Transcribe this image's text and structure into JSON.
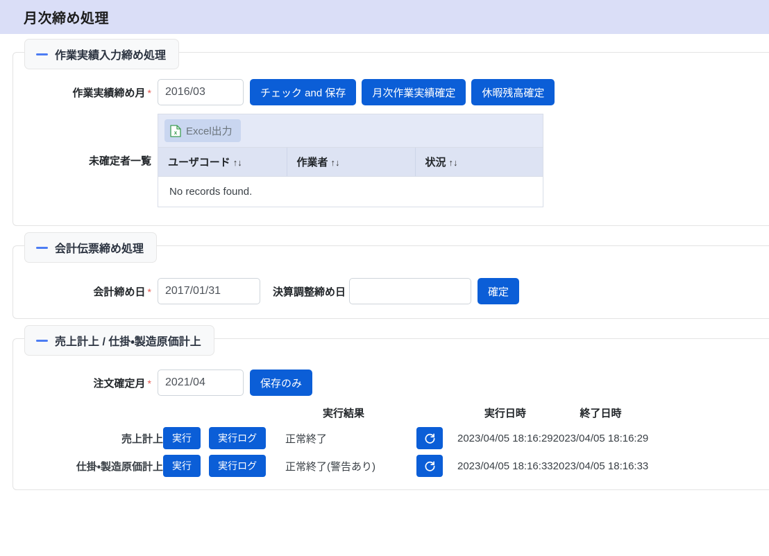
{
  "header": {
    "title": "月次締め処理"
  },
  "sections": [
    {
      "legend": "作業実績入力締め処理",
      "month_label": "作業実績締め月",
      "month_value": "2016/03",
      "month_placeholder": "",
      "buttons": {
        "check_save": "チェック and 保存",
        "monthly_confirm": "月次作業実績確定",
        "leave_balance_confirm": "休暇残高確定"
      },
      "grid_label": "未確定者一覧",
      "excel_button": "Excel出力",
      "grid_headers": [
        "ユーザコード",
        "作業者",
        "状況"
      ],
      "sort_indicator": "↑↓",
      "empty_message": "No records found."
    },
    {
      "legend": "会計伝票締め処理",
      "acc_label": "会計締め日",
      "acc_value": "2017/01/31",
      "adj_label": "決算調整締め日",
      "adj_value": "",
      "adj_placeholder": "",
      "confirm_button": "確定"
    },
    {
      "legend": "売上計上 / 仕掛・製造原価計上",
      "order_label": "注文確定月",
      "order_value": "2021/04",
      "save_only_button": "保存のみ",
      "columns": {
        "result": "実行結果",
        "exec_time": "実行日時",
        "end_time": "終了日時"
      },
      "run_button": "実行",
      "log_button": "実行ログ",
      "rows": [
        {
          "label": "売上計上",
          "result": "正常終了",
          "exec_time": "2023/04/05 18:16:29",
          "end_time": "2023/04/05 18:16:29"
        },
        {
          "label": "仕掛・製造原価計上",
          "result": "正常終了(警告あり)",
          "exec_time": "2023/04/05 18:16:33",
          "end_time": "2023/04/05 18:16:33"
        }
      ]
    }
  ],
  "colors": {
    "header_bg": "#dadef7",
    "primary": "#0b5ed7",
    "accent_dash": "#4c7cf3",
    "required": "#e2574c",
    "grid_header_bg": "#dde3f3",
    "excel_icon": "#3f9e53"
  }
}
